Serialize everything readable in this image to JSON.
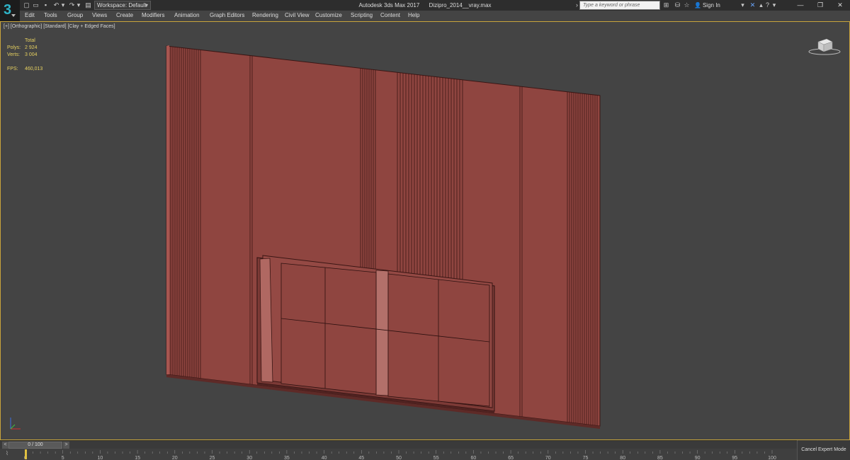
{
  "app": {
    "window_title": "Autodesk 3ds Max 2017",
    "file_name": "Dizipro_2014__vray.max",
    "logo_glyph": "3"
  },
  "quick_access": {
    "icons": [
      "new-file-icon",
      "open-file-icon",
      "save-icon",
      "undo-icon",
      "undo-dropdown-icon",
      "redo-icon",
      "redo-dropdown-icon",
      "project-folder-icon"
    ],
    "workspace_label": "Workspace: Default"
  },
  "search": {
    "placeholder": "Type a keyword or phrase"
  },
  "account": {
    "sign_in_label": "Sign In"
  },
  "menu": {
    "items": [
      "Edit",
      "Tools",
      "Group",
      "Views",
      "Create",
      "Modifiers",
      "Animation",
      "Graph Editors",
      "Rendering",
      "Civil View",
      "Customize",
      "Scripting",
      "Content",
      "Help"
    ]
  },
  "viewport": {
    "label": "[+] [Orthographic] [Standard] [Clay + Edged Faces]",
    "border_color": "#c8a43c",
    "stats": {
      "total_label": "Total",
      "polys_label": "Polys:",
      "polys_value": "2 924",
      "verts_label": "Verts:",
      "verts_value": "3 004",
      "fps_label": "FPS:",
      "fps_value": "460,013"
    },
    "model_color": "#8f4540"
  },
  "timeline": {
    "frame_display": "0 / 100",
    "prev_label": "<",
    "next_label": ">",
    "ticks": [
      "0",
      "5",
      "10",
      "15",
      "20",
      "25",
      "30",
      "35",
      "40",
      "45",
      "50",
      "55",
      "60",
      "65",
      "70",
      "75",
      "80",
      "85",
      "90",
      "95",
      "100"
    ]
  },
  "status": {
    "expert_mode_label": "Cancel Expert Mode"
  },
  "colors": {
    "stats_text": "#e6d060",
    "viewport_bg": "#444444"
  }
}
